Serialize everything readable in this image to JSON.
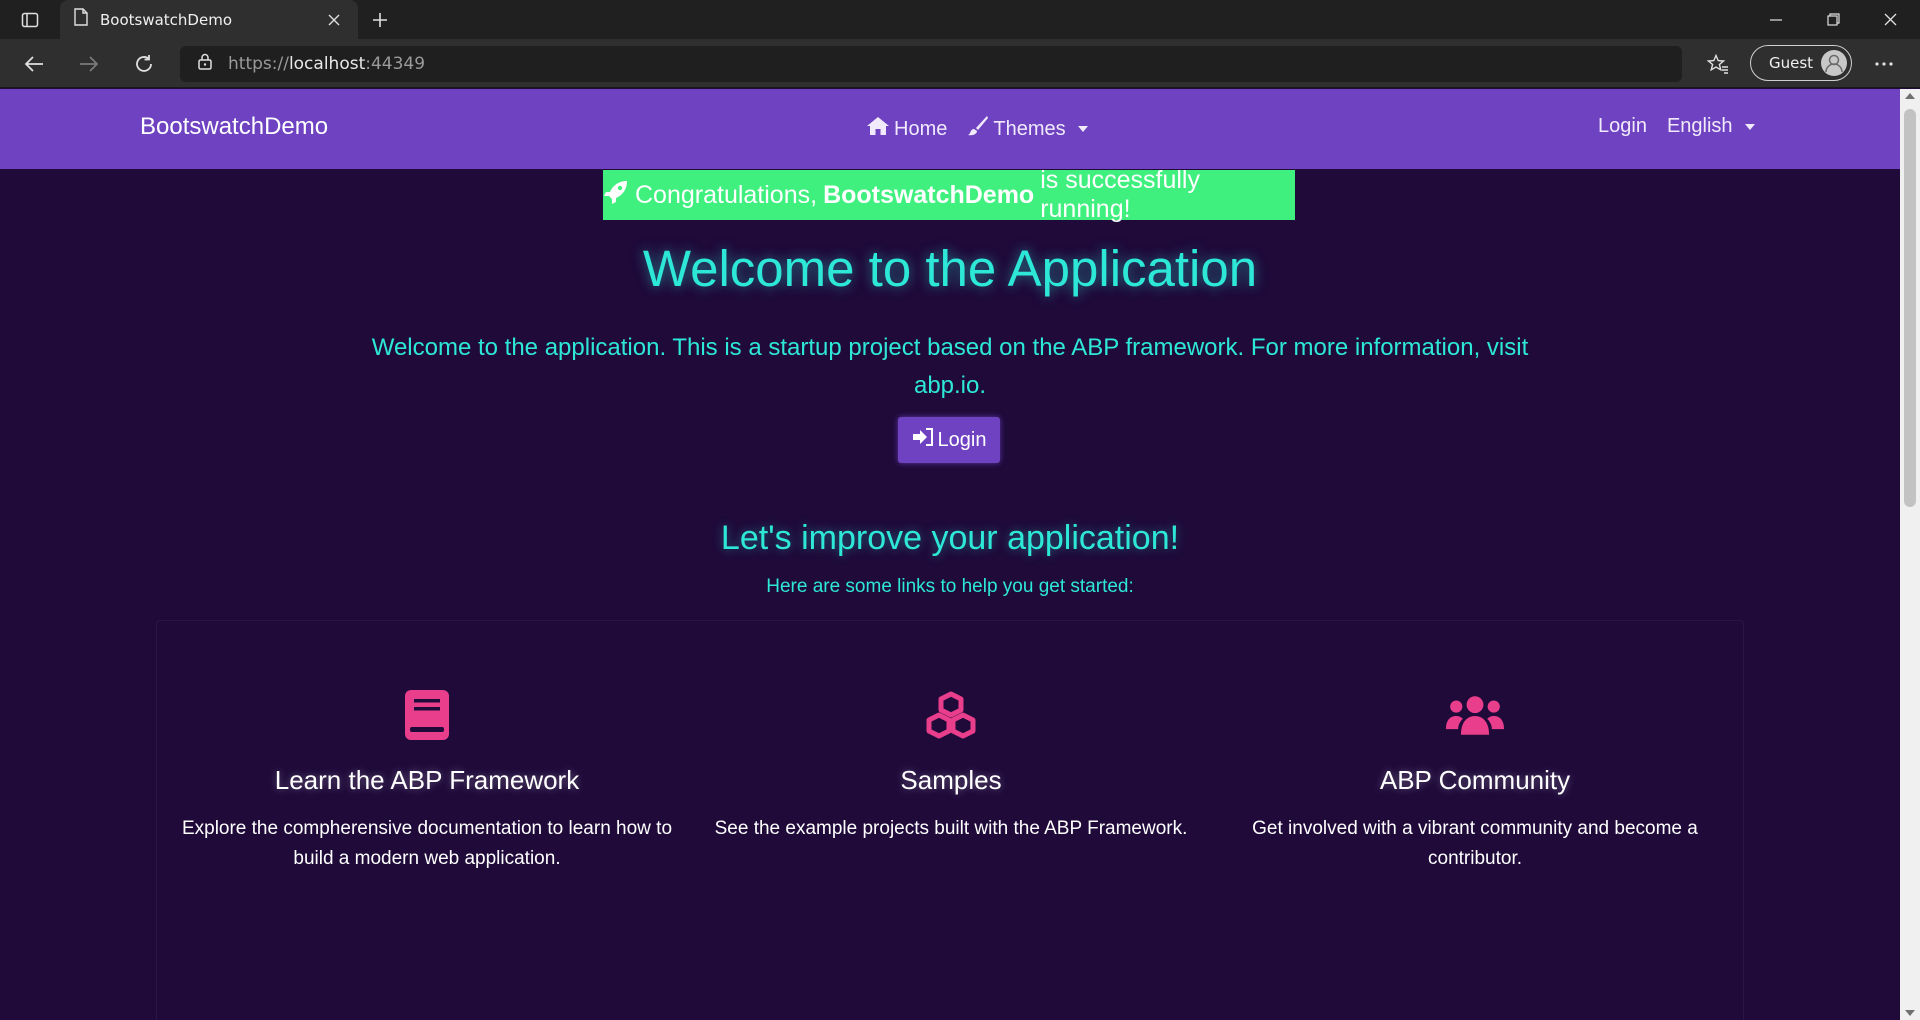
{
  "browser": {
    "tab_title": "BootswatchDemo",
    "url_scheme": "https://",
    "url_host": "localhost",
    "url_port": ":44349",
    "profile_label": "Guest"
  },
  "navbar": {
    "brand": "BootswatchDemo",
    "home_label": "Home",
    "themes_label": "Themes",
    "login_label": "Login",
    "language_label": "English",
    "bg_color": "#6f42c1"
  },
  "hero": {
    "alert_prefix": "Congratulations,",
    "alert_bold": "BootswatchDemo",
    "alert_suffix": "is successfully running!",
    "title": "Welcome to the Application",
    "lead": "Welcome to the application. This is a startup project based on the ABP framework. For more information, visit abp.io.",
    "login_button": "Login",
    "accent_color": "#2ee8d7",
    "alert_color": "#3ff07e"
  },
  "improve": {
    "title": "Let's improve your application!",
    "subtitle": "Here are some links to help you get started:"
  },
  "features": [
    {
      "icon": "book-icon",
      "title": "Learn the ABP Framework",
      "desc": "Explore the compherensive documentation to learn how to build a modern web application."
    },
    {
      "icon": "cubes-icon",
      "title": "Samples",
      "desc": "See the example projects built with the ABP Framework."
    },
    {
      "icon": "users-icon",
      "title": "ABP Community",
      "desc": "Get involved with a vibrant community and become a contributor."
    }
  ],
  "icon_color": "#e83e8c"
}
